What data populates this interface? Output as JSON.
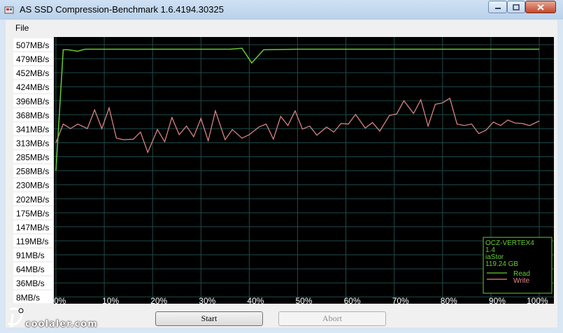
{
  "window": {
    "title": "AS SSD Compression-Benchmark 1.6.4194.30325"
  },
  "menu": {
    "file": "File"
  },
  "buttons": {
    "start": "Start",
    "abort": "Abort"
  },
  "legend": {
    "device": "OCZ-VERTEX4",
    "version": "1.4",
    "driver": "iaStor",
    "size": "119.24 GB",
    "read_label": "Read",
    "write_label": "Write"
  },
  "watermark": "coolaler.com",
  "colors": {
    "read": "#66cc33",
    "write": "#e88a8a",
    "background": "#000000",
    "grid": "#1f4a4a"
  },
  "chart_data": {
    "type": "line",
    "x_ticks": [
      "0%",
      "10%",
      "20%",
      "30%",
      "40%",
      "50%",
      "60%",
      "70%",
      "80%",
      "90%",
      "100%"
    ],
    "y_ticks": [
      "507MB/s",
      "479MB/s",
      "452MB/s",
      "424MB/s",
      "396MB/s",
      "368MB/s",
      "341MB/s",
      "313MB/s",
      "285MB/s",
      "258MB/s",
      "230MB/s",
      "202MB/s",
      "175MB/s",
      "147MB/s",
      "119MB/s",
      "91MB/s",
      "64MB/s",
      "36MB/s",
      "8MB/s"
    ],
    "ylim": [
      8,
      507
    ],
    "xlim": [
      0,
      100
    ],
    "series": [
      {
        "name": "Read",
        "color": "#66cc33",
        "x": [
          0,
          1.5,
          2.5,
          4.5,
          6,
          10,
          20,
          30,
          36,
          38.5,
          40.5,
          43,
          50,
          60,
          70,
          80,
          90,
          100
        ],
        "values": [
          258,
          497,
          497,
          494,
          498,
          498,
          498,
          498,
          498,
          500,
          471,
          497,
          498,
          498,
          498,
          498,
          498,
          498
        ]
      },
      {
        "name": "Write",
        "color": "#e88a8a",
        "x": [
          0,
          1.5,
          3,
          4.5,
          6.5,
          8,
          9.5,
          11,
          12.5,
          14,
          16,
          17.5,
          19,
          21,
          22.5,
          24,
          25.5,
          27,
          28.5,
          30,
          31.5,
          33,
          35,
          36.5,
          38.5,
          40,
          42,
          43.5,
          45,
          46.5,
          48,
          49.5,
          51,
          52.5,
          54,
          56,
          57.5,
          59,
          60.5,
          62,
          64,
          65.5,
          67,
          69,
          70.5,
          72,
          74,
          75.5,
          77,
          78.5,
          80,
          81.5,
          83,
          84.5,
          86,
          87.5,
          89,
          90.5,
          92,
          93.5,
          95,
          96.5,
          98,
          100
        ],
        "values": [
          313,
          350,
          341,
          350,
          341,
          378,
          341,
          382,
          322,
          319,
          320,
          334,
          294,
          339,
          315,
          363,
          329,
          346,
          325,
          361,
          317,
          376,
          319,
          339,
          322,
          329,
          344,
          350,
          320,
          365,
          347,
          376,
          340,
          346,
          328,
          344,
          334,
          351,
          350,
          369,
          342,
          353,
          336,
          367,
          370,
          396,
          371,
          398,
          346,
          389,
          392,
          401,
          350,
          347,
          350,
          331,
          338,
          354,
          347,
          358,
          352,
          351,
          347,
          356
        ]
      }
    ]
  }
}
